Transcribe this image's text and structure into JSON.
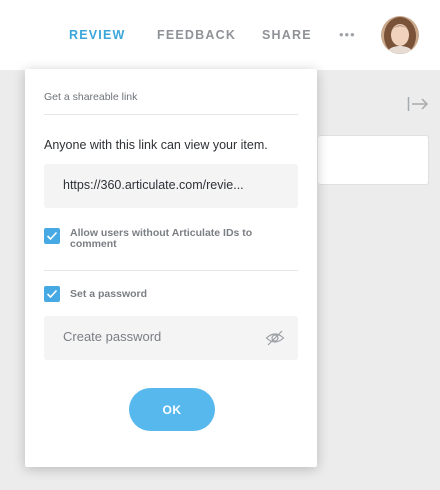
{
  "nav": {
    "tabs": [
      {
        "label": "REVIEW",
        "active": true
      },
      {
        "label": "FEEDBACK",
        "active": false
      },
      {
        "label": "SHARE",
        "active": false
      }
    ],
    "more_label": "•••"
  },
  "share_dialog": {
    "header": "Get a shareable link",
    "description": "Anyone with this link can view your item.",
    "link": "https://360.articulate.com/revie...",
    "options": [
      {
        "label": "Allow users without Articulate IDs to comment",
        "checked": true
      },
      {
        "label": "Set a password",
        "checked": true
      }
    ],
    "password": {
      "value": "",
      "placeholder": "Create password"
    },
    "ok_label": "OK"
  },
  "colors": {
    "accent": "#3aa6d9",
    "checkbox": "#47a9e3",
    "button": "#57b8ee"
  },
  "icons": {
    "collapse": "arrow-to-right-icon",
    "password_toggle": "eye-slash-icon",
    "checkbox_mark": "checkmark-icon"
  }
}
